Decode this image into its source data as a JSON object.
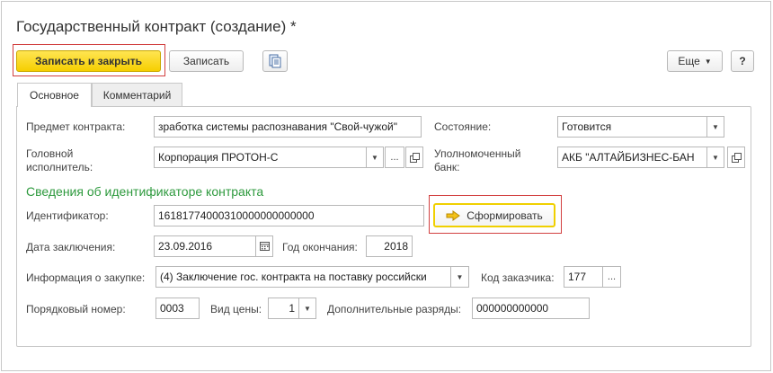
{
  "window": {
    "title": "Государственный контракт (создание) *"
  },
  "toolbar": {
    "save_close_label": "Записать и закрыть",
    "save_label": "Записать",
    "more_label": "Еще",
    "help_label": "?"
  },
  "tabs": [
    {
      "label": "Основное",
      "active": true
    },
    {
      "label": "Комментарий",
      "active": false
    }
  ],
  "form": {
    "subject_label": "Предмет контракта:",
    "subject_value": "зработка системы распознавания \"Свой-чужой\"",
    "status_label": "Состояние:",
    "status_value": "Готовится",
    "contractor_label_line1": "Головной",
    "contractor_label_line2": "исполнитель:",
    "contractor_value": "Корпорация ПРОТОН-С",
    "bank_label_line1": "Уполномоченный",
    "bank_label_line2": "банк:",
    "bank_value": "АКБ \"АЛТАЙБИЗНЕС-БАН",
    "section_title": "Сведения об идентификаторе контракта",
    "identifier_label": "Идентификатор:",
    "identifier_value": "16181774000310000000000000",
    "generate_label": "Сформировать",
    "date_label": "Дата заключения:",
    "date_value": "23.09.2016",
    "end_year_label": "Год окончания:",
    "end_year_value": "2018",
    "purchase_label": "Информация о закупке:",
    "purchase_value": "(4) Заключение гос. контракта на поставку российски",
    "customer_code_label": "Код заказчика:",
    "customer_code_value": "177",
    "ellipsis": "...",
    "order_label": "Порядковый номер:",
    "order_value": "0003",
    "price_type_label": "Вид цены:",
    "price_type_value": "1",
    "extra_digits_label": "Дополнительные разряды:",
    "extra_digits_value": "000000000000"
  },
  "colors": {
    "primary_button": "#f6cf00",
    "highlight_border": "#d24040",
    "section_title": "#2e9a3e"
  }
}
